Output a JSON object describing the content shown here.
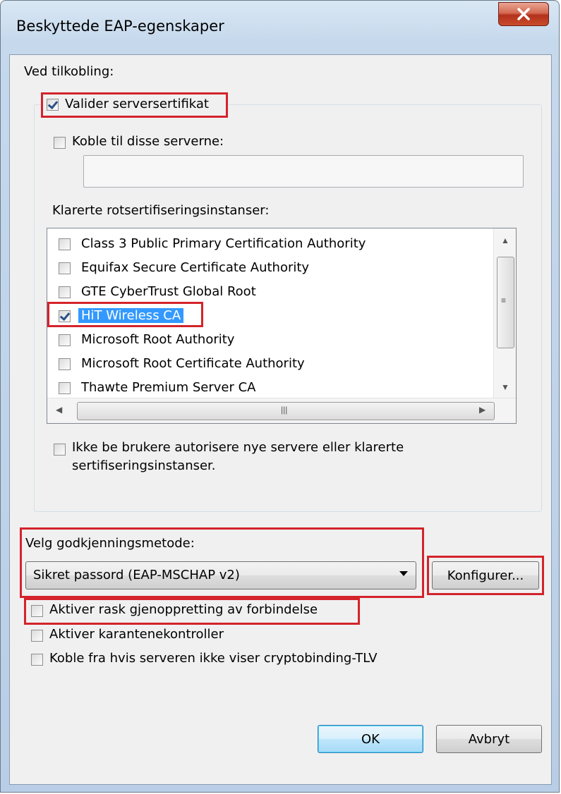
{
  "window": {
    "title": "Beskyttede EAP-egenskaper"
  },
  "connection": {
    "heading": "Ved tilkobling:",
    "validate_cert_label": "Valider serversertifikat",
    "validate_cert_checked": true,
    "connect_servers_label": "Koble til disse serverne:",
    "connect_servers_checked": false,
    "servers_value": "",
    "trusted_roots_label": "Klarerte rotsertifiseringsinstanser:",
    "trusted_roots": [
      {
        "label": "Class 3 Public Primary Certification Authority",
        "checked": false
      },
      {
        "label": "Equifax Secure Certificate Authority",
        "checked": false
      },
      {
        "label": "GTE CyberTrust Global Root",
        "checked": false
      },
      {
        "label": "HiT Wireless CA",
        "checked": true,
        "selected": true
      },
      {
        "label": "Microsoft Root Authority",
        "checked": false
      },
      {
        "label": "Microsoft Root Certificate Authority",
        "checked": false
      },
      {
        "label": "Thawte Premium Server CA",
        "checked": false
      }
    ],
    "no_prompt_label_line1": "Ikke be brukere autorisere nye servere eller klarerte",
    "no_prompt_label_line2": "sertifiseringsinstanser.",
    "no_prompt_checked": false
  },
  "auth": {
    "method_label": "Velg godkjenningsmetode:",
    "method_value": "Sikret passord (EAP-MSCHAP v2)",
    "configure_label": "Konfigurer...",
    "fast_reconnect_label": "Aktiver rask gjenoppretting av forbindelse",
    "fast_reconnect_checked": false,
    "quarantine_label": "Aktiver karantenekontroller",
    "quarantine_checked": false,
    "cryptobinding_label": "Koble fra hvis serveren ikke viser cryptobinding-TLV",
    "cryptobinding_checked": false
  },
  "buttons": {
    "ok_label": "OK",
    "cancel_label": "Avbryt"
  },
  "colors": {
    "highlight_red": "#d4232b",
    "selection_blue": "#3399ff"
  }
}
